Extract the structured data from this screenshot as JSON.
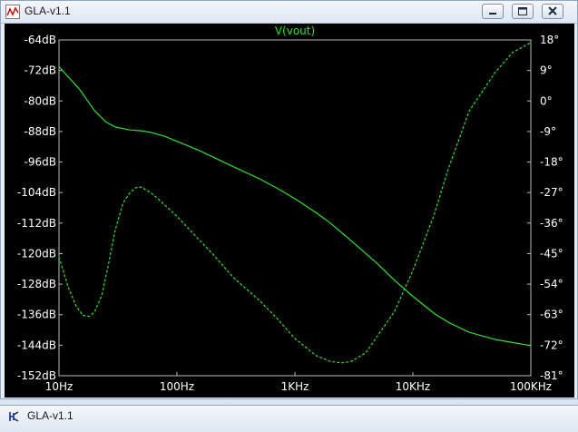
{
  "window": {
    "title": "GLA-v1.1",
    "icon": "waveform-app-icon",
    "controls": [
      "minimize-icon",
      "restore-icon",
      "close-icon"
    ]
  },
  "second_window": {
    "title": "GLA-v1.1",
    "icon": "transistor-app-icon"
  },
  "colors": {
    "background": "#000000",
    "trace": "#2fe02f",
    "title_text": "#2fe02f",
    "axis_text": "#ffffff",
    "frame": "#bdbdbd"
  },
  "chart_data": {
    "type": "line",
    "title": "V(vout)",
    "x_scale": "log",
    "xlim": [
      10,
      100000
    ],
    "x_ticks": [
      10,
      100,
      1000,
      10000,
      100000
    ],
    "x_tick_labels": [
      "10Hz",
      "100Hz",
      "1KHz",
      "10KHz",
      "100KHz"
    ],
    "y_left": {
      "unit": "dB",
      "ylim": [
        -152,
        -64
      ],
      "ticks": [
        -64,
        -72,
        -80,
        -88,
        -96,
        -104,
        -112,
        -120,
        -128,
        -136,
        -144,
        -152
      ],
      "tick_labels": [
        "-64dB",
        "-72dB",
        "-80dB",
        "-88dB",
        "-96dB",
        "-104dB",
        "-112dB",
        "-120dB",
        "-128dB",
        "-136dB",
        "-144dB",
        "-152dB"
      ]
    },
    "y_right": {
      "unit": "°",
      "ylim": [
        -81,
        18
      ],
      "ticks": [
        18,
        9,
        0,
        -9,
        -18,
        -27,
        -36,
        -45,
        -54,
        -63,
        -72,
        -81
      ],
      "tick_labels": [
        "18°",
        "9°",
        "0°",
        "-9°",
        "-18°",
        "-27°",
        "-36°",
        "-45°",
        "-54°",
        "-63°",
        "-72°",
        "-81°"
      ]
    },
    "grid": false,
    "series": [
      {
        "name": "",
        "axis": "left",
        "style": "solid",
        "x": [
          10,
          15,
          20,
          25,
          30,
          40,
          50,
          60,
          80,
          100,
          150,
          200,
          300,
          500,
          700,
          1000,
          1500,
          2000,
          3000,
          5000,
          7000,
          10000,
          15000,
          20000,
          30000,
          50000,
          70000,
          100000
        ],
        "y": [
          -71,
          -77,
          -82.5,
          -85.5,
          -86.8,
          -87.6,
          -87.8,
          -88.2,
          -89.3,
          -90.6,
          -92.8,
          -94.6,
          -97.2,
          -100.4,
          -102.8,
          -105.6,
          -109.2,
          -112,
          -116.6,
          -122.6,
          -127,
          -131.2,
          -135.6,
          -138,
          -140.6,
          -142.5,
          -143.3,
          -144.1
        ]
      },
      {
        "name": "",
        "axis": "right",
        "style": "dashed",
        "x": [
          10,
          12,
          14,
          16,
          18,
          20,
          23,
          26,
          30,
          35,
          40,
          45,
          50,
          60,
          70,
          100,
          150,
          200,
          300,
          500,
          700,
          1000,
          1500,
          2000,
          2500,
          3000,
          4000,
          5000,
          7000,
          10000,
          15000,
          20000,
          30000,
          50000,
          70000,
          100000
        ],
        "y": [
          -46,
          -55,
          -60.5,
          -63.2,
          -63.5,
          -62.2,
          -57.5,
          -49,
          -38,
          -30,
          -27,
          -25.5,
          -25.4,
          -27,
          -29,
          -34,
          -40.5,
          -45,
          -52,
          -58.8,
          -64,
          -70,
          -75,
          -76.8,
          -77.2,
          -76.8,
          -74.2,
          -69.3,
          -62,
          -50,
          -34,
          -20,
          -3,
          8.5,
          14.3,
          17.2
        ]
      }
    ]
  }
}
